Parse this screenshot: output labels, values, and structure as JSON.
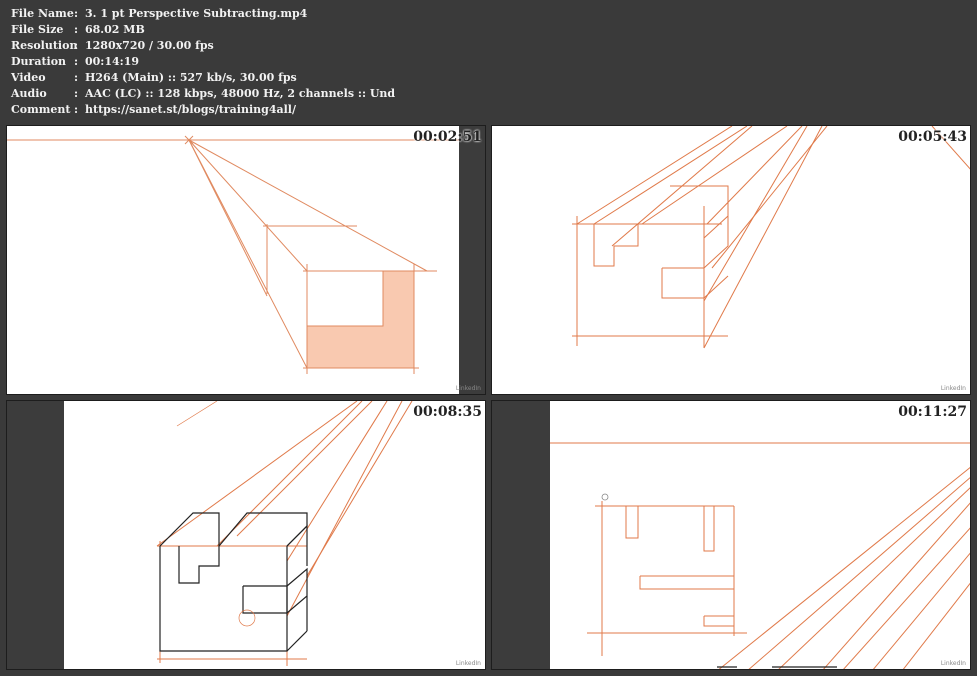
{
  "info": {
    "rows": [
      {
        "key": "File Name",
        "value": "3. 1 pt Perspective Subtracting.mp4"
      },
      {
        "key": "File Size",
        "value": "68.02 MB"
      },
      {
        "key": "Resolution",
        "value": "1280x720 / 30.00 fps"
      },
      {
        "key": "Duration",
        "value": "00:14:19"
      },
      {
        "key": "Video",
        "value": "H264 (Main) :: 527 kb/s, 30.00 fps"
      },
      {
        "key": "Audio",
        "value": "AAC (LC) :: 128 kbps, 48000 Hz, 2 channels :: Und"
      },
      {
        "key": "Comment",
        "value": "https://sanet.st/blogs/training4all/"
      }
    ],
    "separator": ":"
  },
  "thumbnails": [
    {
      "timestamp": "00:02:51",
      "watermark": "LinkedIn"
    },
    {
      "timestamp": "00:05:43",
      "watermark": "LinkedIn"
    },
    {
      "timestamp": "00:08:35",
      "watermark": "LinkedIn"
    },
    {
      "timestamp": "00:11:27",
      "watermark": "LinkedIn"
    }
  ],
  "colors": {
    "background": "#3a3a3a",
    "stroke": "#e07a4a",
    "fill": "#f8c7ad",
    "text": "#f2f2f2"
  }
}
